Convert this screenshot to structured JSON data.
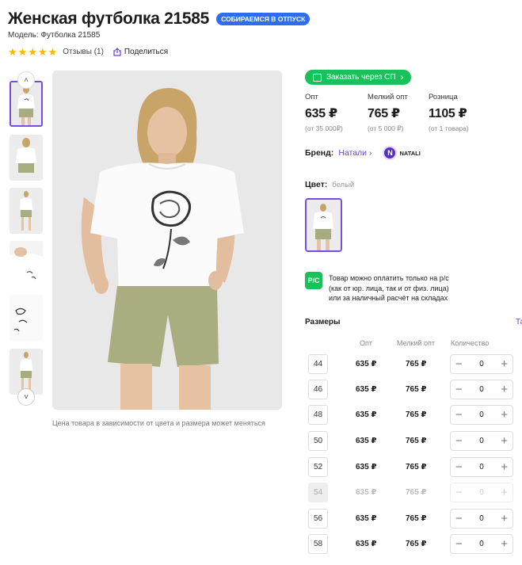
{
  "product": {
    "title": "Женская футболка 21585",
    "promo_badge": "СОБИРАЕМСЯ В ОТПУСК",
    "model": "Модель: Футболка 21585",
    "rating_stars": 5,
    "reviews": "Отзывы (1)",
    "share": "Поделиться"
  },
  "gallery": {
    "note": "Цена товара в зависимости от цвета и размера может меняться",
    "thumbnail_count": 6
  },
  "order_button": {
    "label": "Заказать через СП"
  },
  "prices": [
    {
      "label": "Опт",
      "value": "635 ₽",
      "note": "(от 35 000₽)"
    },
    {
      "label": "Мелкий опт",
      "value": "765 ₽",
      "note": "(от 5 000 ₽)"
    },
    {
      "label": "Розница",
      "value": "1105 ₽",
      "note": "(от 1 товара)"
    }
  ],
  "brand": {
    "label": "Бренд:",
    "name": "Натали",
    "logo_text": "NATALI",
    "logo_letter": "N"
  },
  "color": {
    "label": "Цвет:",
    "value": "белый"
  },
  "payment": {
    "icon_text": "Р/С",
    "line1": "Товар можно оплатить только на р/с",
    "line2": "(как от юр. лица, так и от физ. лица)",
    "line3": "или за наличный расчёт на складах"
  },
  "sizes": {
    "title": "Размеры",
    "link": "Та",
    "headers": {
      "opt": "Опт",
      "small_opt": "Мелкий опт",
      "quantity": "Количество"
    },
    "rows": [
      {
        "size": "44",
        "opt": "635 ₽",
        "small_opt": "765 ₽",
        "qty": "0",
        "available": true
      },
      {
        "size": "46",
        "opt": "635 ₽",
        "small_opt": "765 ₽",
        "qty": "0",
        "available": true
      },
      {
        "size": "48",
        "opt": "635 ₽",
        "small_opt": "765 ₽",
        "qty": "0",
        "available": true
      },
      {
        "size": "50",
        "opt": "635 ₽",
        "small_opt": "765 ₽",
        "qty": "0",
        "available": true
      },
      {
        "size": "52",
        "opt": "635 ₽",
        "small_opt": "765 ₽",
        "qty": "0",
        "available": true
      },
      {
        "size": "54",
        "opt": "635 ₽",
        "small_opt": "765 ₽",
        "qty": "0",
        "available": false
      },
      {
        "size": "56",
        "opt": "635 ₽",
        "small_opt": "765 ₽",
        "qty": "0",
        "available": true
      },
      {
        "size": "58",
        "opt": "635 ₽",
        "small_opt": "765 ₽",
        "qty": "0",
        "available": true
      }
    ]
  },
  "colors": {
    "accent": "#7a4cdb",
    "green": "#19c15a",
    "badge_blue": "#2f6df0",
    "star": "#f5b700"
  }
}
